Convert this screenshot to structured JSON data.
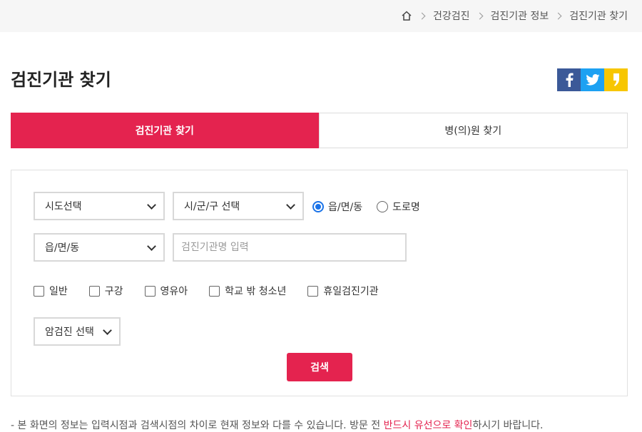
{
  "breadcrumb": {
    "items": [
      "건강검진",
      "검진기관 정보",
      "검진기관 찾기"
    ]
  },
  "icons": {
    "home": "home-icon",
    "facebook": "facebook-icon",
    "twitter": "twitter-icon",
    "kakaostory": "kakaostory-icon"
  },
  "colors": {
    "accent": "#e4234f",
    "facebook": "#3b5998",
    "twitter": "#1da1f2",
    "kakaostory": "#f7c600"
  },
  "page": {
    "title": "검진기관 찾기"
  },
  "tabs": [
    {
      "label": "검진기관 찾기",
      "active": true
    },
    {
      "label": "병(의)원 찾기",
      "active": false
    }
  ],
  "form": {
    "sido_select": "시도선택",
    "sigungu_select": "시/군/구 선택",
    "address_type": [
      {
        "label": "읍/면/동",
        "selected": true
      },
      {
        "label": "도로명",
        "selected": false
      }
    ],
    "dong_select": "읍/면/동",
    "name_input_placeholder": "검진기관명 입력",
    "checkboxes": [
      {
        "label": "일반",
        "checked": false
      },
      {
        "label": "구강",
        "checked": false
      },
      {
        "label": "영유아",
        "checked": false
      },
      {
        "label": "학교 밖 청소년",
        "checked": false
      },
      {
        "label": "휴일검진기관",
        "checked": false
      }
    ],
    "cancer_select": "암검진 선택",
    "search_label": "검색"
  },
  "notice": {
    "text_before": "- 본 화면의 정보는 입력시점과 검색시점의 차이로 현재 정보와 다를 수 있습니다. 방문 전 ",
    "text_emphasis": "반드시 유선으로 확인",
    "text_after": "하시기 바랍니다."
  }
}
